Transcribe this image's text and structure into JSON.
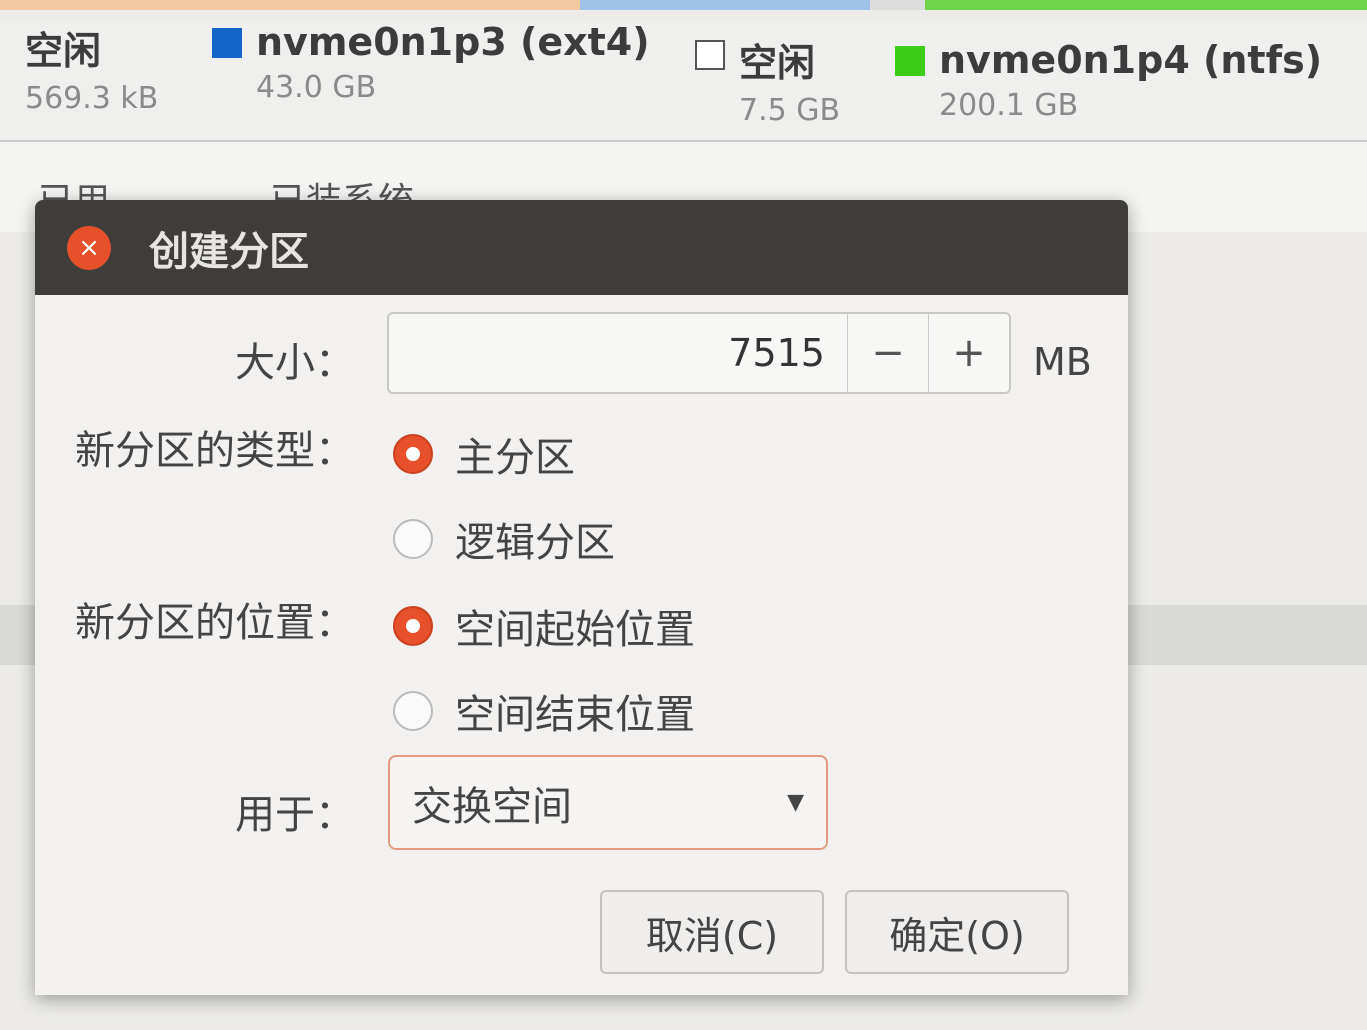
{
  "legend": [
    {
      "name": "空闲",
      "size": "569.3 kB",
      "color": "#ffffff"
    },
    {
      "name": "nvme0n1p3 (ext4)",
      "size": "43.0 GB",
      "color": "#1565c8"
    },
    {
      "name": "空闲",
      "size": "7.5 GB",
      "color": "#ffffff"
    },
    {
      "name": "nvme0n1p4 (ntfs)",
      "size": "200.1 GB",
      "color": "#3ccd18"
    }
  ],
  "columns": [
    "已用",
    "已装系统"
  ],
  "dialog": {
    "title": "创建分区",
    "size_label": "大小：",
    "size_value": "7515",
    "size_unit": "MB",
    "minus": "−",
    "plus": "+",
    "type_label": "新分区的类型：",
    "type_options": [
      "主分区",
      "逻辑分区"
    ],
    "type_selected": 0,
    "location_label": "新分区的位置：",
    "location_options": [
      "空间起始位置",
      "空间结束位置"
    ],
    "location_selected": 0,
    "use_label": "用于：",
    "use_value": "交换空间",
    "cancel": "取消(C)",
    "ok": "确定(O)"
  }
}
